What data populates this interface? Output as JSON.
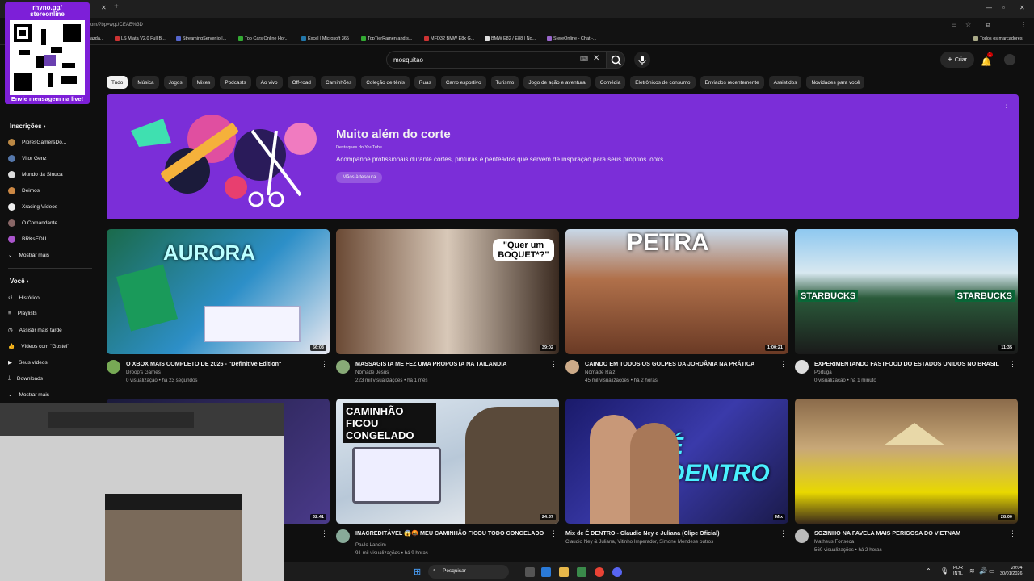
{
  "overlay": {
    "handle": "rhyno.gg/\nstereonline",
    "handle_l1": "rhyno.gg/",
    "handle_l2": "stereonline",
    "cta": "Envie mensagem na live!"
  },
  "browser": {
    "address_fragment": "om/?bp=wgUCEAE%3D",
    "bookmarks": [
      "azda...",
      "LS Miata V2.0 Full B...",
      "StreamingServer.io |...",
      "Top Cars Online Hor...",
      "Excel | Microsoft 365",
      "TopTierRamen and s...",
      "MFD32 BMW E8x G...",
      "BMW E82 / E88 | No...",
      "StereOnline - Chat -..."
    ],
    "all_bookmarks": "Todos os marcadores"
  },
  "header": {
    "search_value": "mosquitao",
    "create_label": "Criar",
    "notif_count": "1"
  },
  "chips": [
    "Tudo",
    "Música",
    "Jogos",
    "Mixes",
    "Podcasts",
    "Ao vivo",
    "Off-road",
    "Caminhões",
    "Coleção de tênis",
    "Ruas",
    "Carro esportivo",
    "Turismo",
    "Jogo de ação e aventura",
    "Comédia",
    "Eletrônicos de consumo",
    "Enviados recentemente",
    "Assistidos",
    "Novidades para você"
  ],
  "banner": {
    "title": "Muito além do corte",
    "source": "Destaques do YouTube",
    "desc": "Acompanhe profissionais durante cortes, pinturas e penteados que servem de inspiração para seus próprios looks",
    "button": "Mãos à tesoura"
  },
  "sidebar": {
    "subs_title": "Inscrições",
    "subs": [
      "PioresGamersDo...",
      "Vitor Genz",
      "Mundo da Slnuca",
      "Deimos",
      "Xracing Vídeos",
      "O Comandante",
      "BRKsEDU"
    ],
    "more": "Mostrar mais",
    "you_title": "Você",
    "you": [
      "Histórico",
      "Playlists",
      "Assistir mais tarde",
      "Vídeos com \"Gostei\"",
      "Seus vídeos",
      "Downloads",
      "Mostrar mais"
    ]
  },
  "videos": [
    {
      "title": "O XBOX MAIS COMPLETO DE 2026 - \"Definitive Edition\"",
      "channel": "Droop's Games",
      "stats": "0 visualização • há 23 segundos",
      "duration": "56:03",
      "overlay": "AURORA"
    },
    {
      "title": "MASSAGISTA ME FEZ UMA PROPOSTA NA TAILANDIA",
      "channel": "Nômade Jesus",
      "stats": "223 mil visualizações • há 1 mês",
      "duration": "39:02",
      "overlay": "\"Quer um BOQUET*?\""
    },
    {
      "title": "CAINDO EM TODOS OS GOLPES DA JORDÂNIA NA PRÁTICA",
      "channel": "Nômade Raiz",
      "stats": "45 mil visualizações • há 2 horas",
      "duration": "1:00:21",
      "overlay": "PETRA"
    },
    {
      "title": "EXPERIMENTANDO FASTFOOD DO ESTADOS UNIDOS NO BRASIL",
      "channel": "Portuga",
      "stats": "0 visualização • há 1 minuto",
      "duration": "11:35",
      "overlay": "STARBUCKS"
    },
    {
      "title": "",
      "channel": "",
      "stats": "",
      "duration": "32:41",
      "overlay": ""
    },
    {
      "title": "INACREDITÁVEL 😱🤬 MEU CAMINHÃO FICOU TODO CONGELADO",
      "channel": "Paulo Landim",
      "stats": "91 mil visualizações • há 9 horas",
      "duration": "24:37",
      "overlay": "CAMINHÃO FICOU CONGELADO"
    },
    {
      "title": "Mix de É DENTRO - Claudio Ney e Juliana (Clipe Oficial)",
      "channel": "Claudio Ney & Juliana, Vitinho Imperador, Simone Mendese outros",
      "stats": "",
      "duration": "Mix",
      "overlay": "É DENTRO"
    },
    {
      "title": "SOZINHO NA FAVELA MAIS PERIGOSA DO VIETNAM",
      "channel": "Matheus Fonseca",
      "stats": "560 visualizações • há 2 horas",
      "duration": "28:00",
      "overlay": ""
    }
  ],
  "taskbar": {
    "search": "Pesquisar",
    "lang": "POR\nINTL",
    "lang_l1": "POR",
    "lang_l2": "INTL",
    "time": "20:04",
    "date": "30/01/2026"
  },
  "colors": {
    "banner": "#7b2ed8",
    "overlay": "#7d1fd8",
    "bg": "#0f0f0f",
    "notif": "#cc0000"
  }
}
